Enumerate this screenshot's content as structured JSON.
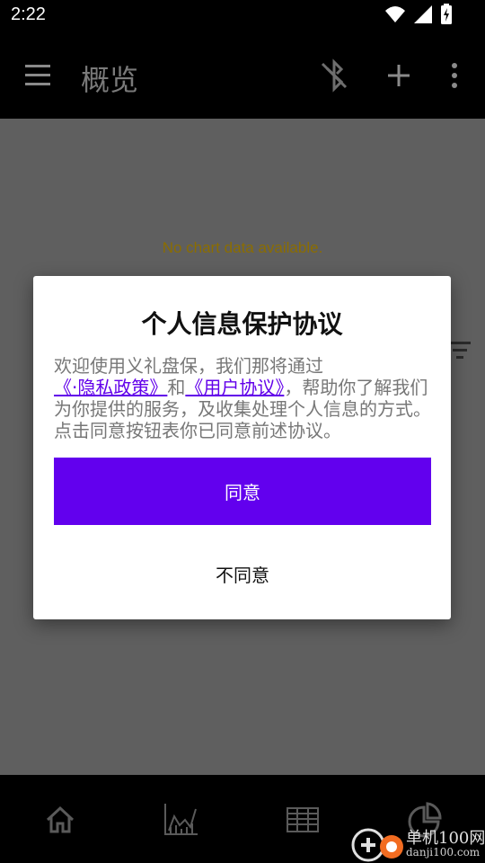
{
  "status_bar": {
    "time": "2:22",
    "icons": [
      "wifi-icon",
      "signal-icon",
      "battery-charging-icon"
    ]
  },
  "app_bar": {
    "title": "概览",
    "icons": [
      "menu-icon",
      "bluetooth-disabled-icon",
      "add-icon",
      "more-vert-icon"
    ]
  },
  "main": {
    "empty_message": "No chart data available.",
    "filter_icon": "filter-icon"
  },
  "dialog": {
    "title": "个人信息保护协议",
    "body_intro": "欢迎使用义礼盘保，我们那将通过",
    "privacy_link": "《·隐私政策》",
    "conj": "和",
    "user_link": "《用户协议》",
    "body_rest": "，帮助你了解我们为你提供的服务，及收集处理个人信息的方式。",
    "body_last": "点击同意按钮表你已同意前述协议。",
    "agree_label": "同意",
    "disagree_label": "不同意"
  },
  "bottom_nav": {
    "items": [
      "home-icon",
      "line-chart-icon",
      "table-icon",
      "pie-chart-icon"
    ]
  },
  "watermark": {
    "cn": "单机100网",
    "en": "danji100.com"
  },
  "colors": {
    "accent": "#6200ee",
    "link": "#6200ea",
    "overlay": "#5f5f5f",
    "empty_text": "#8b6d00"
  }
}
